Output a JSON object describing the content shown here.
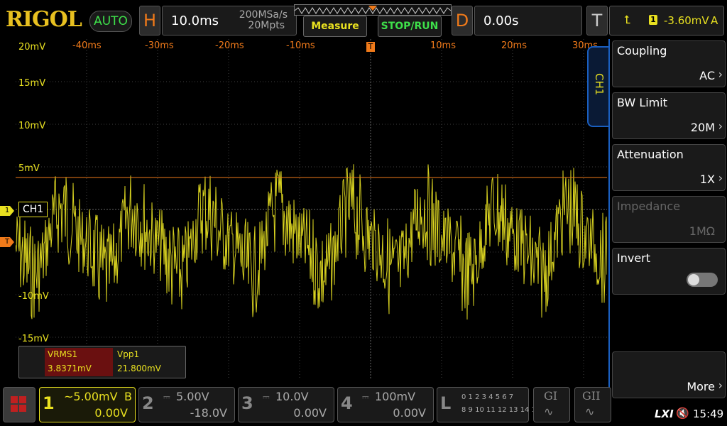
{
  "brand": "RIGOL",
  "auto_label": "AUTO",
  "horizontal": {
    "letter": "H",
    "timebase": "10.0ms",
    "sample_rate": "200MSa/s",
    "memory_depth": "20Mpts"
  },
  "measure_label": "Measure",
  "stop_run_label": "STOP/RUN",
  "delay": {
    "letter": "D",
    "value": "0.00s"
  },
  "trigger": {
    "letter": "T",
    "channel": "1",
    "level": "-3.60mV",
    "mode": "A"
  },
  "x_ticks": [
    "-40ms",
    "-30ms",
    "-20ms",
    "-10ms",
    "10ms",
    "20ms",
    "30ms"
  ],
  "y_ticks": [
    "20mV",
    "15mV",
    "10mV",
    "5mV",
    "-10mV",
    "-15mV",
    "-20mV"
  ],
  "ch1_marker": {
    "num": "1",
    "label": "CH1"
  },
  "trig_marker": "T",
  "measurements": [
    {
      "name": "VRMS1",
      "value": "3.8371mV"
    },
    {
      "name": "Vpp1",
      "value": "21.800mV"
    }
  ],
  "menu": {
    "tab": "CH1",
    "items": [
      {
        "title": "Coupling",
        "value": "AC"
      },
      {
        "title": "BW Limit",
        "value": "20M"
      },
      {
        "title": "Attenuation",
        "value": "1X"
      },
      {
        "title": "Impedance",
        "value": "1MΩ"
      },
      {
        "title": "Invert",
        "value": ""
      },
      {
        "title": "",
        "value": "More"
      }
    ]
  },
  "channels": [
    {
      "num": "1",
      "scale": "~5.00mV",
      "flag": "B",
      "offset": "0.00V"
    },
    {
      "num": "2",
      "scale": "5.00V",
      "offset": "-18.0V"
    },
    {
      "num": "3",
      "scale": "10.0V",
      "offset": "0.00V"
    },
    {
      "num": "4",
      "scale": "100mV",
      "offset": "0.00V"
    }
  ],
  "logic": {
    "letter": "L",
    "row1": "0 1 2 3  4 5 6 7",
    "row2": "8 9 10 11 12 13 14 15"
  },
  "gen1": "GI",
  "gen2": "GII",
  "lxi": "LXI",
  "time": "15:49",
  "colors": {
    "ch1": "#e8e020",
    "accent": "#f07a1a",
    "menu_border": "#1a5fc0"
  },
  "chart_data": {
    "type": "line",
    "title": "",
    "xlabel": "",
    "ylabel": "",
    "xlim": [
      -50,
      30
    ],
    "ylim": [
      -20,
      20
    ],
    "trigger_level_mV": 3.6,
    "series": [
      {
        "name": "CH1",
        "description_values": "noisy periodic waveform ~100Hz, Vpp 21.8mV"
      }
    ]
  }
}
